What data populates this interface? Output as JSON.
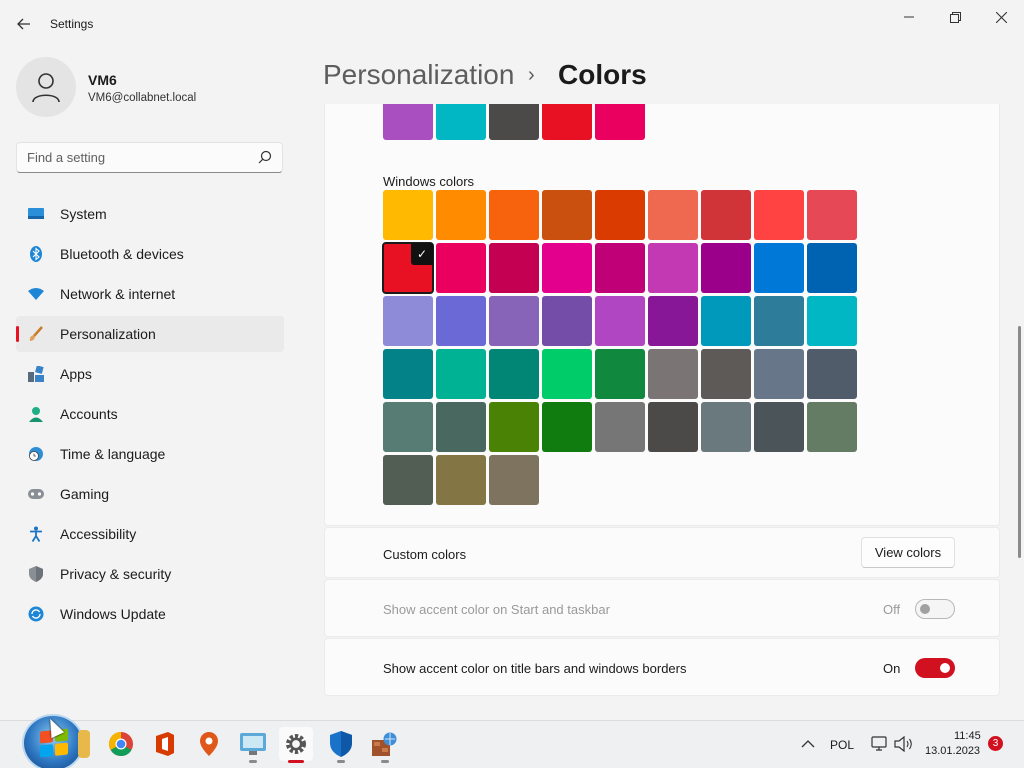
{
  "window": {
    "title": "Settings",
    "back_icon": "arrow-left-icon",
    "minimize_icon": "minimize-icon",
    "maximize_icon": "restore-icon",
    "close_icon": "close-icon"
  },
  "profile": {
    "name": "VM6",
    "email": "VM6@collabnet.local"
  },
  "search": {
    "placeholder": "Find a setting"
  },
  "nav": {
    "items": [
      {
        "label": "System",
        "icon": "monitor-icon"
      },
      {
        "label": "Bluetooth & devices",
        "icon": "bluetooth-icon"
      },
      {
        "label": "Network & internet",
        "icon": "wifi-icon"
      },
      {
        "label": "Personalization",
        "icon": "brush-icon",
        "active": true
      },
      {
        "label": "Apps",
        "icon": "apps-icon"
      },
      {
        "label": "Accounts",
        "icon": "person-icon"
      },
      {
        "label": "Time & language",
        "icon": "clock-globe-icon"
      },
      {
        "label": "Gaming",
        "icon": "gamepad-icon"
      },
      {
        "label": "Accessibility",
        "icon": "accessibility-icon"
      },
      {
        "label": "Privacy & security",
        "icon": "shield-icon"
      },
      {
        "label": "Windows Update",
        "icon": "sync-icon"
      }
    ]
  },
  "header": {
    "parent": "Personalization",
    "separator": "›",
    "current": "Colors"
  },
  "recent_colors": [
    "#a94fc0",
    "#00b7c3",
    "#4c4a48",
    "#e81123",
    "#ea005e"
  ],
  "windows_colors": {
    "label": "Windows colors",
    "selected": "#e81123",
    "rows": [
      [
        "#ffb900",
        "#ff8c00",
        "#f7630c",
        "#ca5010",
        "#da3b01",
        "#ef6950",
        "#d13438",
        "#ff4343",
        "#e74856"
      ],
      [
        "#e81123",
        "#ea005e",
        "#c30052",
        "#e3008c",
        "#bf0077",
        "#c239b3",
        "#9a0089",
        "#0078d7",
        "#0063b1"
      ],
      [
        "#8e8cd8",
        "#6b69d6",
        "#8764b8",
        "#744da9",
        "#b146c2",
        "#881798",
        "#0099bc",
        "#2d7d9a",
        "#00b7c3"
      ],
      [
        "#038387",
        "#00b294",
        "#018574",
        "#00cc6a",
        "#10893e",
        "#7a7574",
        "#5d5a58",
        "#68768a",
        "#515c6b"
      ],
      [
        "#567c73",
        "#486860",
        "#498205",
        "#107c10",
        "#767676",
        "#4c4a48",
        "#69797e",
        "#4a5459",
        "#647c64"
      ],
      [
        "#525e54",
        "#847545",
        "#7e735f"
      ]
    ]
  },
  "custom_colors": {
    "label": "Custom colors",
    "button": "View colors"
  },
  "start_taskbar": {
    "label": "Show accent color on Start and taskbar",
    "state": "Off"
  },
  "title_bars": {
    "label": "Show accent color on title bars and windows borders",
    "state": "On"
  },
  "taskbar": {
    "tray": {
      "language": "POL",
      "time": "11:45",
      "date": "13.01.2023",
      "notifications": "3"
    }
  }
}
